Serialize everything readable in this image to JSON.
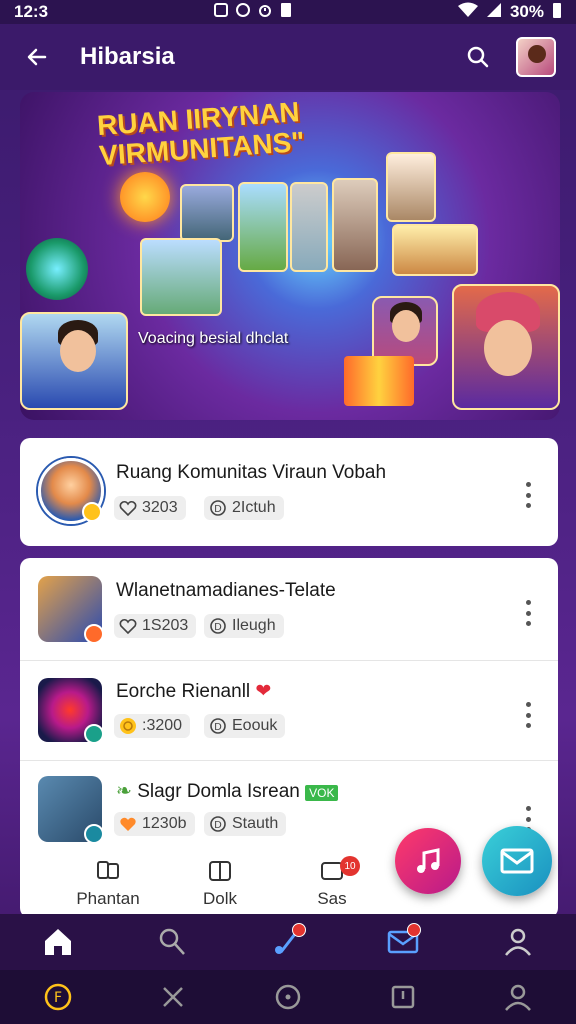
{
  "status_bar": {
    "time": "12:3",
    "icons_mid": [
      "nfc-icon",
      "sync-icon",
      "alarm-icon",
      "battery-saver-icon"
    ],
    "battery": "30%"
  },
  "app_bar": {
    "title": "Hibarsia"
  },
  "banner": {
    "title_line1": "RUAN IIRYNAN",
    "title_line2": "VIRMUNITANS\"",
    "subtitle": "Voacing besial dhclat"
  },
  "featured_item": {
    "title": "Ruang Komunitas Viraun Vobah",
    "stat1_value": "3203",
    "stat2_value": "2Ictuh"
  },
  "list_items": [
    {
      "title": "Wlanetnamadianes-Telate",
      "stat1_value": "1S203",
      "stat2_value": "Ileugh"
    },
    {
      "title": "Eorche Rienanll",
      "stat1_value": ":3200",
      "stat2_value": "Eoouk"
    },
    {
      "title": "Slagr Domla Isrean",
      "tag": "VOK",
      "stat1_value": "1230b",
      "stat2_value": "Stauth"
    }
  ],
  "card_tabs": [
    {
      "label": "Phantan"
    },
    {
      "label": "Dolk"
    },
    {
      "label": "Sas",
      "badge": "10"
    }
  ],
  "colors": {
    "accent_purple": "#4a2180",
    "fab_music": "#ff3a6a",
    "fab_mail": "#3ad0d8",
    "nav_active": "#ffffff"
  }
}
